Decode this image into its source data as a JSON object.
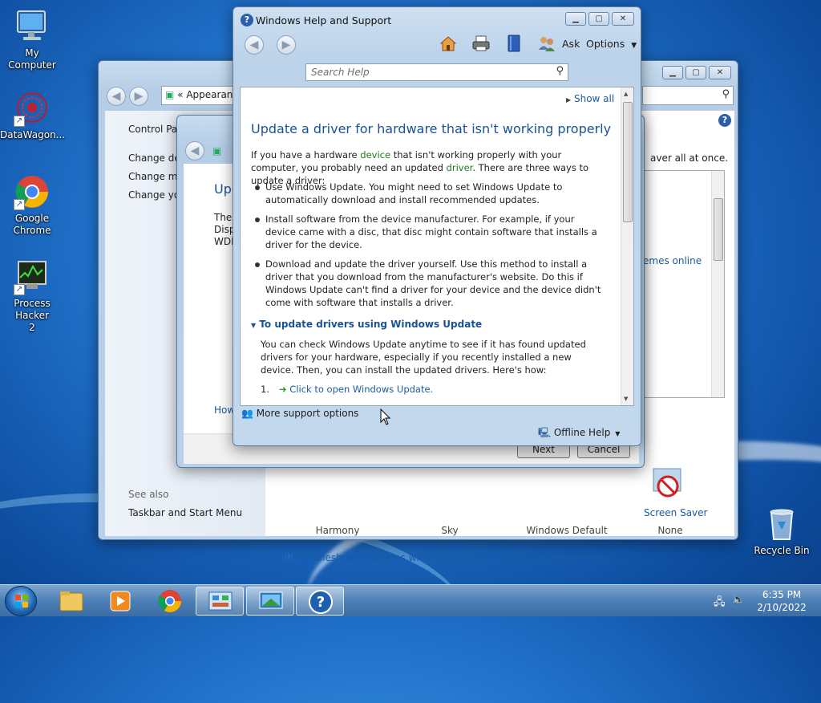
{
  "desktop": {
    "icons": [
      {
        "label": "My Computer"
      },
      {
        "label": "DataWagon..."
      },
      {
        "label": "Google Chrome"
      },
      {
        "label": "Process Hacker 2"
      },
      {
        "label": "Recycle Bin"
      }
    ]
  },
  "personalization": {
    "address": "Appearan",
    "nav_prefix": "«",
    "left_panel": {
      "home_link": "Control Pan",
      "links": [
        "Change des",
        "Change mo",
        "Change you"
      ],
      "see_also_heading": "See also",
      "see_also_link": "Taskbar and Start Menu"
    },
    "right_text": "aver all at once.",
    "themes_online": "emes online",
    "themes": [
      "Harmony",
      "Sky",
      "Windows Default",
      "None"
    ],
    "screen_saver_label": "Screen Saver",
    "troubleshoot_link": "Troubleshoot problems with transparency and other Aero effects"
  },
  "display_dialog": {
    "heading": "Upd",
    "lines": [
      "The",
      "Disp",
      "WDD"
    ],
    "how_link": "How",
    "next_button": "Next",
    "cancel_button": "Cancel"
  },
  "help": {
    "title": "Windows Help and Support",
    "ask_label": "Ask",
    "options_label": "Options",
    "search_placeholder": "Search Help",
    "show_all": "Show all",
    "heading": "Update a driver for hardware that isn't working properly",
    "intro_1": "If you have a hardware ",
    "intro_device": "device",
    "intro_2": " that isn't working properly with your computer, you probably need an updated ",
    "intro_driver": "driver",
    "intro_3": ". There are three ways to update a driver:",
    "bullets": [
      "Use Windows Update. You might need to set Windows Update to automatically download and install recommended updates.",
      "Install software from the device manufacturer. For example, if your device came with a disc, that disc might contain software that installs a driver for the device.",
      "Download and update the driver yourself. Use this method to install a driver that you download from the manufacturer's website. Do this if Windows Update can't find a driver for your device and the device didn't come with software that installs a driver."
    ],
    "section_heading": "To update drivers using Windows Update",
    "section_text": "You can check Windows Update anytime to see if it has found updated drivers for your hardware, especially if you recently installed a new device. Then, you can install the updated drivers. Here's how:",
    "step_number": "1.",
    "step_link": "Click to open Windows Update.",
    "more_support": "More support options",
    "offline_help": "Offline Help"
  },
  "tray": {
    "time": "6:35 PM",
    "date": "2/10/2022"
  },
  "colors": {
    "link": "#1a5a9e",
    "glossary": "#207a20",
    "heading": "#1a5296"
  }
}
